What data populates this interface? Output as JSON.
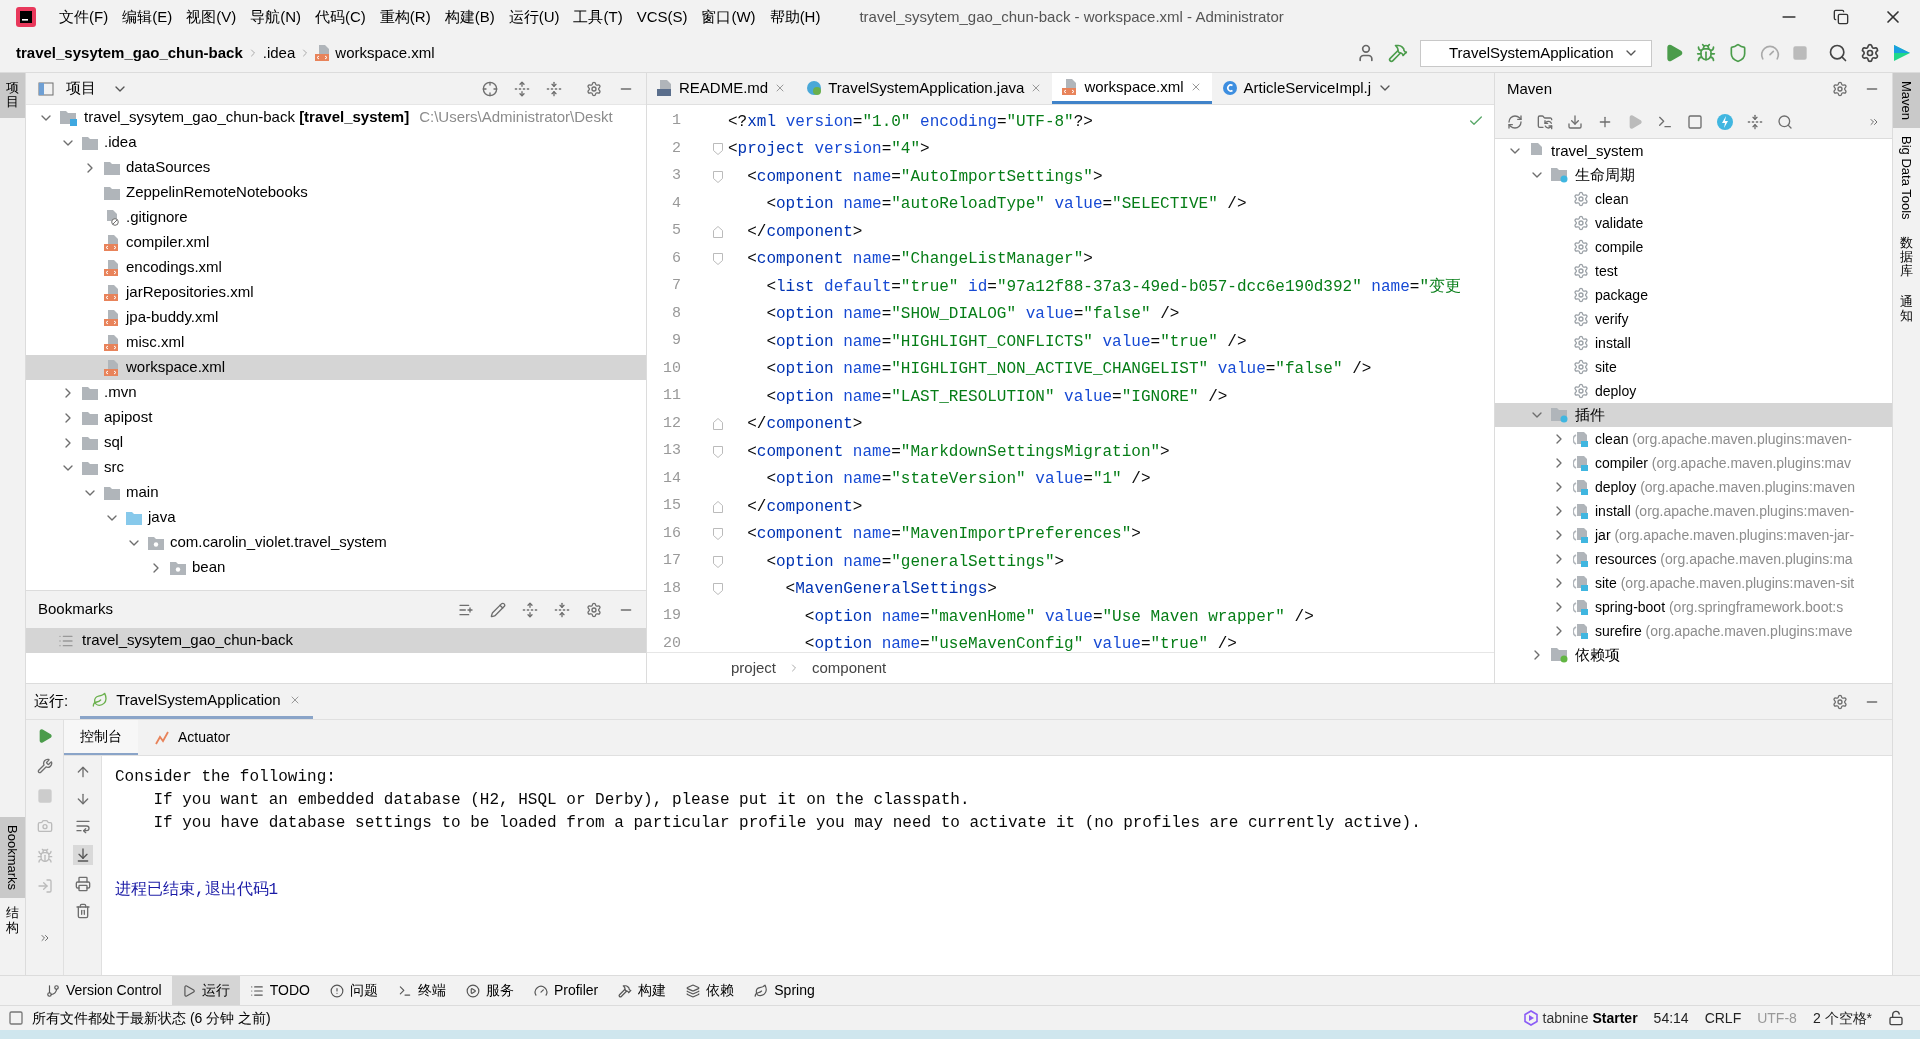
{
  "menu": [
    "文件(F)",
    "编辑(E)",
    "视图(V)",
    "导航(N)",
    "代码(C)",
    "重构(R)",
    "构建(B)",
    "运行(U)",
    "工具(T)",
    "VCS(S)",
    "窗口(W)",
    "帮助(H)"
  ],
  "window_title": "travel_sysytem_gao_chun-back - workspace.xml - Administrator",
  "breadcrumbs": [
    {
      "label": "travel_sysytem_gao_chun-back",
      "kind": "project"
    },
    {
      "label": ".idea",
      "kind": "folder"
    },
    {
      "label": "workspace.xml",
      "kind": "xml"
    }
  ],
  "run_config": "TravelSystemApplication",
  "left_strip": {
    "top": [
      {
        "label": "项目",
        "kind": "cjk",
        "selected": true
      }
    ],
    "bottom": [
      {
        "label": "Bookmarks",
        "kind": "latin",
        "selected": true
      },
      {
        "label": "结构",
        "kind": "cjk",
        "selected": false
      }
    ]
  },
  "project_panel": {
    "title": "项目",
    "tree": [
      {
        "name": "travel_sysytem_gao_chun-back",
        "module": "[travel_system]",
        "path": "C:\\Users\\Administrator\\Deskt",
        "kind": "module",
        "expanded": true,
        "selected": false,
        "children": [
          {
            "name": ".idea",
            "kind": "folder",
            "expanded": true,
            "selected": false,
            "children": [
              {
                "name": "dataSources",
                "kind": "folder",
                "expanded": false,
                "selected": false
              },
              {
                "name": "ZeppelinRemoteNotebooks",
                "kind": "folder",
                "selected": false
              },
              {
                "name": ".gitignore",
                "kind": "ignore",
                "selected": false
              },
              {
                "name": "compiler.xml",
                "kind": "xml",
                "selected": false
              },
              {
                "name": "encodings.xml",
                "kind": "xml",
                "selected": false
              },
              {
                "name": "jarRepositories.xml",
                "kind": "xml",
                "selected": false
              },
              {
                "name": "jpa-buddy.xml",
                "kind": "xml",
                "selected": false
              },
              {
                "name": "misc.xml",
                "kind": "xml",
                "selected": false
              },
              {
                "name": "workspace.xml",
                "kind": "xml",
                "selected": true
              }
            ]
          },
          {
            "name": ".mvn",
            "kind": "folder",
            "expanded": false,
            "selected": false
          },
          {
            "name": "apipost",
            "kind": "folder",
            "expanded": false,
            "selected": false
          },
          {
            "name": "sql",
            "kind": "folder",
            "expanded": false,
            "selected": false
          },
          {
            "name": "src",
            "kind": "folder",
            "expanded": true,
            "selected": false,
            "children": [
              {
                "name": "main",
                "kind": "folder",
                "expanded": true,
                "selected": false,
                "children": [
                  {
                    "name": "java",
                    "kind": "source",
                    "expanded": true,
                    "selected": false,
                    "children": [
                      {
                        "name": "com.carolin_violet.travel_system",
                        "kind": "package",
                        "expanded": true,
                        "selected": false,
                        "children": [
                          {
                            "name": "bean",
                            "kind": "package",
                            "expanded": false,
                            "selected": false
                          }
                        ]
                      }
                    ]
                  }
                ]
              }
            ]
          }
        ]
      }
    ]
  },
  "bookmarks": {
    "title": "Bookmarks",
    "items": [
      {
        "label": "travel_sysytem_gao_chun-back",
        "selected": true
      }
    ]
  },
  "editor": {
    "tabs": [
      {
        "label": "README.md",
        "kind": "markdown",
        "selected": false,
        "closable": true
      },
      {
        "label": "TravelSystemApplication.java",
        "kind": "spring",
        "selected": false,
        "closable": true
      },
      {
        "label": "workspace.xml",
        "kind": "xml",
        "selected": true,
        "closable": true
      },
      {
        "label": "ArticleServiceImpl.j",
        "kind": "class",
        "selected": false,
        "closable": false
      }
    ],
    "lines": [
      {
        "number": "1",
        "text": "<?xml version=\"1.0\" encoding=\"UTF-8\"?>",
        "kind": "plain"
      },
      {
        "number": "2",
        "text": "<project version=\"4\">",
        "kind": "fold_start"
      },
      {
        "number": "3",
        "text": "  <component name=\"AutoImportSettings\">",
        "kind": "fold_start"
      },
      {
        "number": "4",
        "text": "    <option name=\"autoReloadType\" value=\"SELECTIVE\" />",
        "kind": "plain"
      },
      {
        "number": "5",
        "text": "  </component>",
        "kind": "fold_end"
      },
      {
        "number": "6",
        "text": "  <component name=\"ChangeListManager\">",
        "kind": "fold_start"
      },
      {
        "number": "7",
        "text": "    <list default=\"true\" id=\"97a12f88-37a3-49ed-b057-dcc6e190d392\" name=\"变更",
        "kind": "plain"
      },
      {
        "number": "8",
        "text": "    <option name=\"SHOW_DIALOG\" value=\"false\" />",
        "kind": "plain"
      },
      {
        "number": "9",
        "text": "    <option name=\"HIGHLIGHT_CONFLICTS\" value=\"true\" />",
        "kind": "plain"
      },
      {
        "number": "10",
        "text": "    <option name=\"HIGHLIGHT_NON_ACTIVE_CHANGELIST\" value=\"false\" />",
        "kind": "plain"
      },
      {
        "number": "11",
        "text": "    <option name=\"LAST_RESOLUTION\" value=\"IGNORE\" />",
        "kind": "plain"
      },
      {
        "number": "12",
        "text": "  </component>",
        "kind": "fold_end"
      },
      {
        "number": "13",
        "text": "  <component name=\"MarkdownSettingsMigration\">",
        "kind": "fold_start"
      },
      {
        "number": "14",
        "text": "    <option name=\"stateVersion\" value=\"1\" />",
        "kind": "plain"
      },
      {
        "number": "15",
        "text": "  </component>",
        "kind": "fold_end"
      },
      {
        "number": "16",
        "text": "  <component name=\"MavenImportPreferences\">",
        "kind": "fold_start"
      },
      {
        "number": "17",
        "text": "    <option name=\"generalSettings\">",
        "kind": "fold_start"
      },
      {
        "number": "18",
        "text": "      <MavenGeneralSettings>",
        "kind": "fold_start"
      },
      {
        "number": "19",
        "text": "        <option name=\"mavenHome\" value=\"Use Maven wrapper\" />",
        "kind": "plain"
      },
      {
        "number": "20",
        "text": "        <option name=\"useMavenConfig\" value=\"true\" />",
        "kind": "plain"
      }
    ],
    "path": [
      "project",
      "component"
    ]
  },
  "maven": {
    "title": "Maven",
    "root": {
      "name": "travel_system",
      "expanded": true,
      "groups": [
        {
          "name": "生命周期",
          "kind": "lifecycle",
          "expanded": true,
          "selected": false,
          "items": [
            {
              "name": "clean"
            },
            {
              "name": "validate"
            },
            {
              "name": "compile"
            },
            {
              "name": "test"
            },
            {
              "name": "package"
            },
            {
              "name": "verify"
            },
            {
              "name": "install"
            },
            {
              "name": "site"
            },
            {
              "name": "deploy"
            }
          ]
        },
        {
          "name": "插件",
          "kind": "plugins",
          "expanded": true,
          "selected": true,
          "items": [
            {
              "name": "clean",
              "detail": "(org.apache.maven.plugins:maven-"
            },
            {
              "name": "compiler",
              "detail": "(org.apache.maven.plugins:mav"
            },
            {
              "name": "deploy",
              "detail": "(org.apache.maven.plugins:maven"
            },
            {
              "name": "install",
              "detail": "(org.apache.maven.plugins:maven-"
            },
            {
              "name": "jar",
              "detail": "(org.apache.maven.plugins:maven-jar-"
            },
            {
              "name": "resources",
              "detail": "(org.apache.maven.plugins:ma"
            },
            {
              "name": "site",
              "detail": "(org.apache.maven.plugins:maven-sit"
            },
            {
              "name": "spring-boot",
              "detail": "(org.springframework.boot:s"
            },
            {
              "name": "surefire",
              "detail": "(org.apache.maven.plugins:mave"
            }
          ]
        },
        {
          "name": "依赖项",
          "kind": "deps",
          "expanded": false,
          "selected": false
        }
      ]
    }
  },
  "right_strip": [
    {
      "label": "Maven",
      "kind": "maven",
      "selected": true
    },
    {
      "label": "Big Data Tools",
      "kind": "bigdata",
      "selected": false
    },
    {
      "label": "数据库",
      "kind": "database",
      "selected": false
    },
    {
      "label": "通知",
      "kind": "notifications",
      "selected": false
    }
  ],
  "run_panel": {
    "label": "运行:",
    "tabs": [
      {
        "label": "TravelSystemApplication",
        "selected": true
      }
    ],
    "subtabs": [
      {
        "label": "控制台",
        "kind": "console",
        "selected": true
      },
      {
        "label": "Actuator",
        "kind": "actuator",
        "selected": false
      }
    ],
    "console": [
      {
        "text": "Consider the following:",
        "kind": "output"
      },
      {
        "text": "    If you want an embedded database (H2, HSQL or Derby), please put it on the classpath.",
        "kind": "output"
      },
      {
        "text": "    If you have database settings to be loaded from a particular profile you may need to activate it (no profiles are currently active).",
        "kind": "output"
      },
      {
        "text": "进程已结束,退出代码1",
        "kind": "exit"
      }
    ]
  },
  "tool_tabs": [
    {
      "label": "Version Control",
      "kind": "vcs",
      "selected": false
    },
    {
      "label": "运行",
      "kind": "run",
      "selected": true
    },
    {
      "label": "TODO",
      "kind": "todo",
      "selected": false
    },
    {
      "label": "问题",
      "kind": "problems",
      "selected": false
    },
    {
      "label": "终端",
      "kind": "terminal",
      "selected": false
    },
    {
      "label": "服务",
      "kind": "services",
      "selected": false
    },
    {
      "label": "Profiler",
      "kind": "profiler",
      "selected": false
    },
    {
      "label": "构建",
      "kind": "build",
      "selected": false
    },
    {
      "label": "依赖",
      "kind": "deps",
      "selected": false
    },
    {
      "label": "Spring",
      "kind": "spring",
      "selected": false
    }
  ],
  "status_bar": {
    "message": "所有文件都处于最新状态 (6 分钟 之前)",
    "plugin": {
      "name": "tabnine",
      "tier": "Starter"
    },
    "items": [
      {
        "label": "54:14",
        "dimmed": false
      },
      {
        "label": "CRLF",
        "dimmed": false
      },
      {
        "label": "UTF-8",
        "dimmed": true
      },
      {
        "label": "2 个空格*",
        "dimmed": false
      }
    ]
  }
}
